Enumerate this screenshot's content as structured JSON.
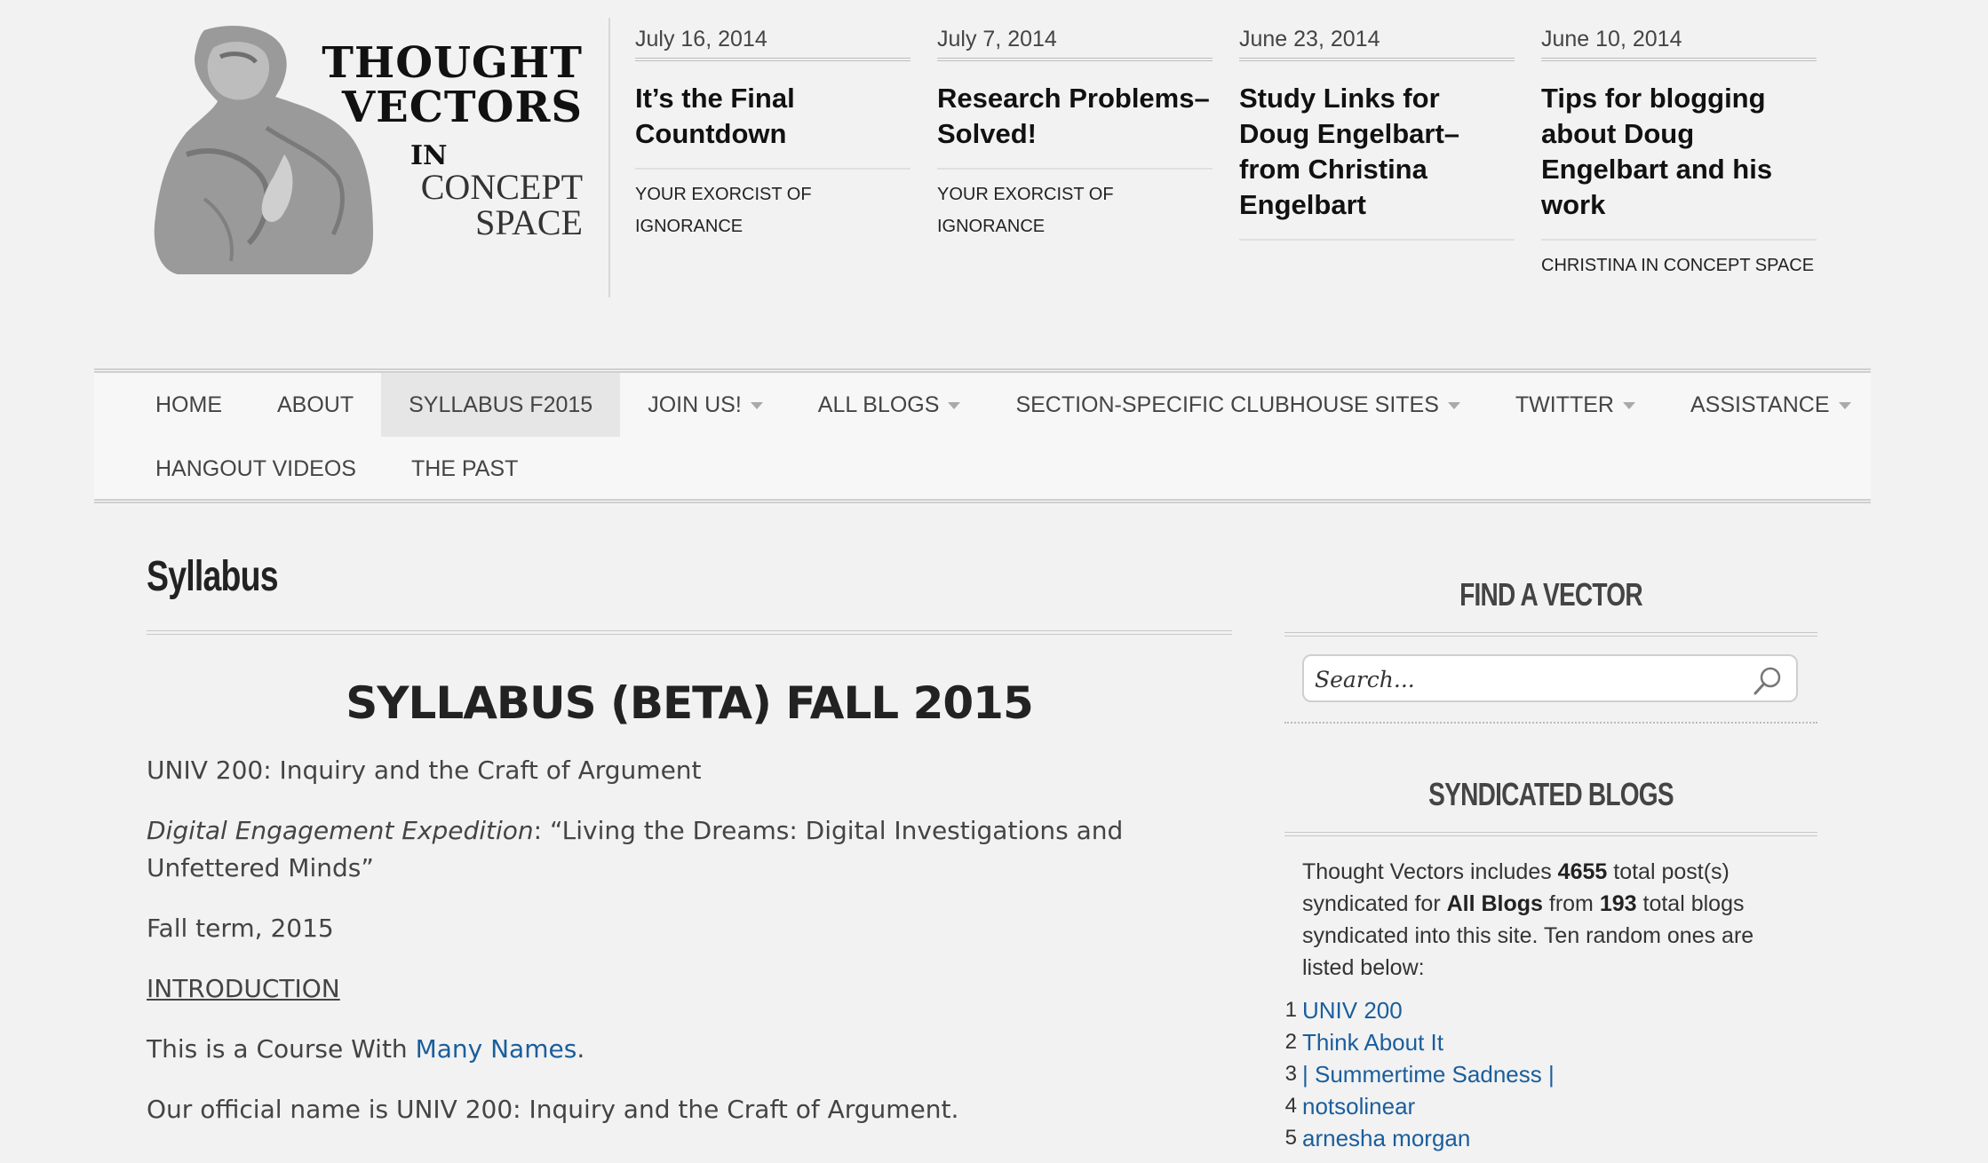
{
  "site": {
    "logo_line1": "THOUGHT",
    "logo_line2": "VECTORS",
    "logo_in": "IN",
    "logo_line3": "CONCEPT",
    "logo_line4": "SPACE"
  },
  "featured_posts": [
    {
      "date": "July 16, 2014",
      "title": "It’s the Final Countdown",
      "category": "YOUR EXORCIST OF IGNORANCE"
    },
    {
      "date": "July 7, 2014",
      "title": "Research Problems–Solved!",
      "category": "YOUR EXORCIST OF IGNORANCE"
    },
    {
      "date": "June 23, 2014",
      "title": "Study Links for Doug Engelbart–from Christina Engelbart",
      "category": ""
    },
    {
      "date": "June 10, 2014",
      "title": "Tips for blogging about Doug Engelbart and his work",
      "category": "CHRISTINA IN CONCEPT SPACE"
    }
  ],
  "nav": {
    "items": [
      {
        "label": "HOME"
      },
      {
        "label": "ABOUT"
      },
      {
        "label": "SYLLABUS F2015"
      },
      {
        "label": "JOIN US!"
      },
      {
        "label": "ALL BLOGS"
      },
      {
        "label": "SECTION-SPECIFIC CLUBHOUSE SITES"
      },
      {
        "label": "TWITTER"
      },
      {
        "label": "ASSISTANCE"
      },
      {
        "label": "HANGOUT VIDEOS"
      },
      {
        "label": "THE PAST"
      }
    ]
  },
  "main": {
    "page_title": "Syllabus",
    "heading": "SYLLABUS (BETA) FALL 2015",
    "course": "UNIV 200: Inquiry and the Craft of Argument",
    "expedition_label": "Digital Engagement Expedition",
    "expedition_text": ": “Living the Dreams: Digital Investigations and Unfettered Minds”",
    "term": "Fall term, 2015",
    "intro_heading": "INTRODUCTION",
    "names_prefix": "This is a Course With ",
    "names_link": "Many Names",
    "names_suffix": ".",
    "official_name": "Our official name is UNIV 200: Inquiry and the Craft of Argument."
  },
  "sidebar": {
    "find_title": "FIND A VECTOR",
    "search_placeholder": "Search...",
    "synd_title": "SYNDICATED BLOGS",
    "synd_t1": "Thought Vectors includes ",
    "synd_posts": "4655",
    "synd_t2": " total post(s) syndicated for ",
    "synd_all": "All Blogs",
    "synd_t3": " from ",
    "synd_blogs": "193",
    "synd_t4": " total blogs syndicated into this site. Ten random ones are listed below:",
    "blogs": [
      {
        "num": "1.",
        "name": "UNIV 200"
      },
      {
        "num": "2.",
        "name": "Think About It"
      },
      {
        "num": "3.",
        "name": "| Summertime Sadness |"
      },
      {
        "num": "4.",
        "name": "notsolinear"
      },
      {
        "num": "5.",
        "name": "arnesha morgan"
      }
    ]
  },
  "colors": {
    "link": "#1a5e9c",
    "background": "#f2f2f2",
    "nav_active": "#e6e6e6"
  },
  "icons": {
    "search": "magnifier-icon",
    "dropdown": "triangle-down-icon"
  }
}
